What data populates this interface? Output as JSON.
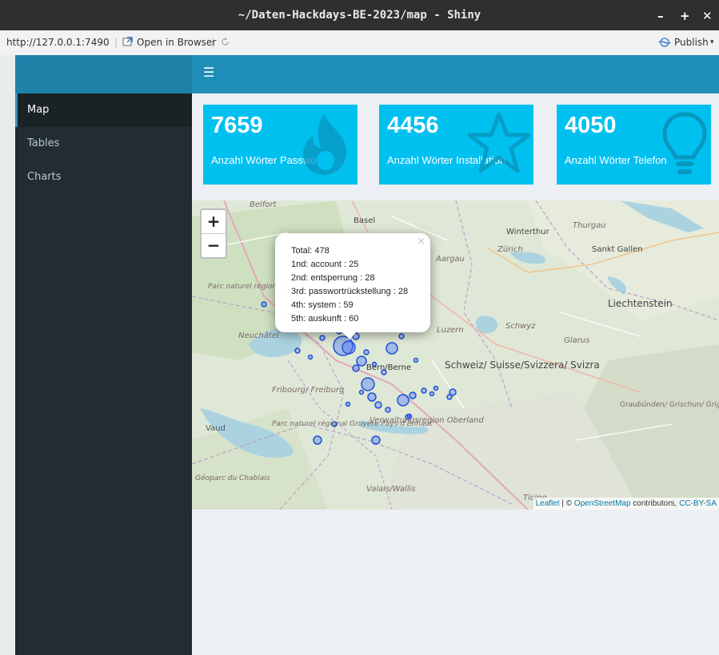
{
  "window": {
    "title": "~/Daten-Hackdays-BE-2023/map - Shiny"
  },
  "window_controls": {
    "minimize": "–",
    "maximize": "+",
    "close": "✕"
  },
  "toolbar": {
    "url": "http://127.0.0.1:7490",
    "open_browser": "Open in Browser",
    "publish": "Publish"
  },
  "sidebar": {
    "items": [
      {
        "label": "Map"
      },
      {
        "label": "Tables"
      },
      {
        "label": "Charts"
      }
    ]
  },
  "header": {
    "menu_icon": "hamburger-icon"
  },
  "valueboxes": [
    {
      "value": "7659",
      "label": "Anzahl Wörter Passwort",
      "icon": "fire-icon"
    },
    {
      "value": "4456",
      "label": "Anzahl Wörter Installation",
      "icon": "star-icon"
    },
    {
      "value": "4050",
      "label": "Anzahl Wörter Telefon",
      "icon": "lightbulb-icon"
    }
  ],
  "map": {
    "zoom_in": "+",
    "zoom_out": "−",
    "places": [
      {
        "name": "Belfort"
      },
      {
        "name": "Basel"
      },
      {
        "name": "Winterthur"
      },
      {
        "name": "Thurgau"
      },
      {
        "name": "Zürich"
      },
      {
        "name": "Sankt Gallen"
      },
      {
        "name": "Aargau"
      },
      {
        "name": "Parc naturel régional du Doubs Horloger"
      },
      {
        "name": "Liechtenstein"
      },
      {
        "name": "Neuchâtel"
      },
      {
        "name": "Luzern"
      },
      {
        "name": "Schwyz"
      },
      {
        "name": "Glarus"
      },
      {
        "name": "Bern/Berne"
      },
      {
        "name": "Schweiz/ Suisse/Svizzera/ Svizra"
      },
      {
        "name": "Fribourg/ Freiburg"
      },
      {
        "name": "Verwaltungsregion Oberland"
      },
      {
        "name": "Parc naturel régional Gruyère Pays-d'Enhaut"
      },
      {
        "name": "Graubünden/ Grischun/ Grigioni"
      },
      {
        "name": "Vaud"
      },
      {
        "name": "Géoparc du Chablais"
      },
      {
        "name": "Valais/Wallis"
      },
      {
        "name": "Ticino"
      }
    ],
    "popup": {
      "close": "×",
      "lines": [
        "Total: 478",
        "1nd: account : 25",
        "2nd: entsperrung : 28",
        "3rd: passwortrückstellung : 28",
        "4th: system : 59",
        "5th: auskunft : 60"
      ]
    },
    "attribution": {
      "leaflet": "Leaflet",
      "sep": " | © ",
      "osm": "OpenStreetMap",
      "contrib": " contributors, ",
      "license": "CC-BY-SA"
    }
  },
  "colors": {
    "sidebar_bg": "#222d32",
    "header_bg": "#1e8eb8",
    "valuebox_bg": "#00c0ef",
    "marker": "#2a52f5"
  }
}
